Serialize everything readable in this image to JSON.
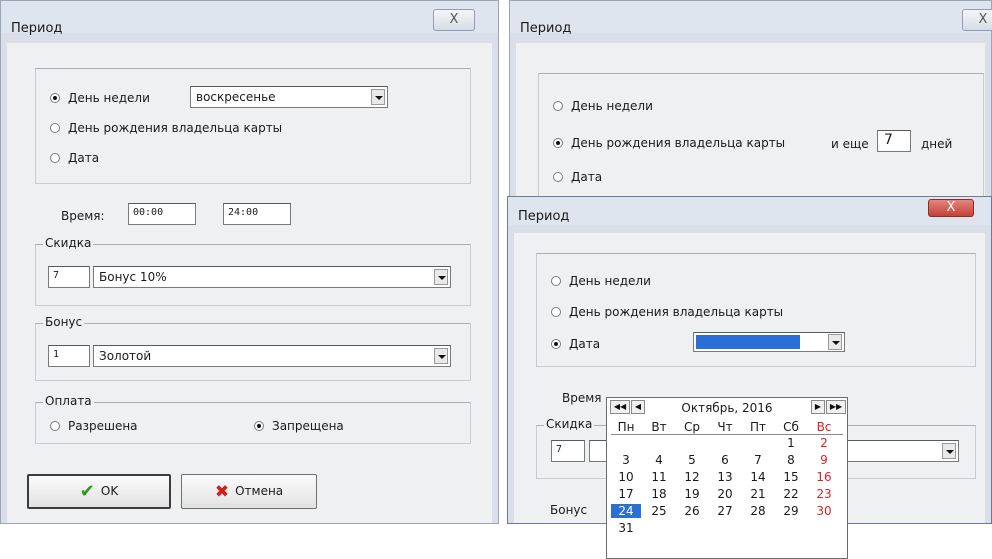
{
  "dialog_left": {
    "title": "Период",
    "close": "X",
    "period": {
      "options": [
        "День недели",
        "День рождения владельца карты",
        "Дата"
      ],
      "selected": 0,
      "weekday_value": "воскресенье"
    },
    "time": {
      "label": "Время:",
      "from": "00:00",
      "to": "24:00"
    },
    "discount": {
      "caption": "Скидка",
      "code": "7",
      "value": "Бонус 10%"
    },
    "bonus": {
      "caption": "Бонус",
      "code": "1",
      "value": "Золотой"
    },
    "payment": {
      "caption": "Оплата",
      "allowed": "Разрешена",
      "forbidden": "Запрещена",
      "selected": "forbidden"
    },
    "ok_label": "OK",
    "cancel_label": "Отмена"
  },
  "dialog_right_back": {
    "title": "Период",
    "close": "X",
    "options": [
      "День недели",
      "День рождения владельца карты",
      "Дата"
    ],
    "selected": 1,
    "and_more_label": "и еще",
    "days_value": "7",
    "days_label": "дней"
  },
  "dialog_right_front": {
    "title": "Период",
    "close": "X",
    "options": [
      "День недели",
      "День рождения владельца карты",
      "Дата"
    ],
    "selected": 2,
    "time_label_partial": "Время",
    "discount_caption": "Скидка",
    "discount_code": "7",
    "bonus_caption_partial": "Бонус",
    "calendar": {
      "month_label": "Октябрь, 2016",
      "nav": {
        "prev_year": "◀◀",
        "prev_month": "◀",
        "next_month": "▶",
        "next_year": "▶▶"
      },
      "weekdays": [
        "Пн",
        "Вт",
        "Ср",
        "Чт",
        "Пт",
        "Сб",
        "Вс"
      ],
      "weeks": [
        [
          "",
          "",
          "",
          "",
          "",
          "1",
          "2"
        ],
        [
          "3",
          "4",
          "5",
          "6",
          "7",
          "8",
          "9"
        ],
        [
          "10",
          "11",
          "12",
          "13",
          "14",
          "15",
          "16"
        ],
        [
          "17",
          "18",
          "19",
          "20",
          "21",
          "22",
          "23"
        ],
        [
          "24",
          "25",
          "26",
          "27",
          "28",
          "29",
          "30"
        ],
        [
          "31",
          "",
          "",
          "",
          "",
          "",
          ""
        ]
      ],
      "selected_day": "24"
    }
  },
  "colors": {
    "accent": "#2a6fd6",
    "weekend": "#d92323",
    "close_active": "#c94a43"
  }
}
